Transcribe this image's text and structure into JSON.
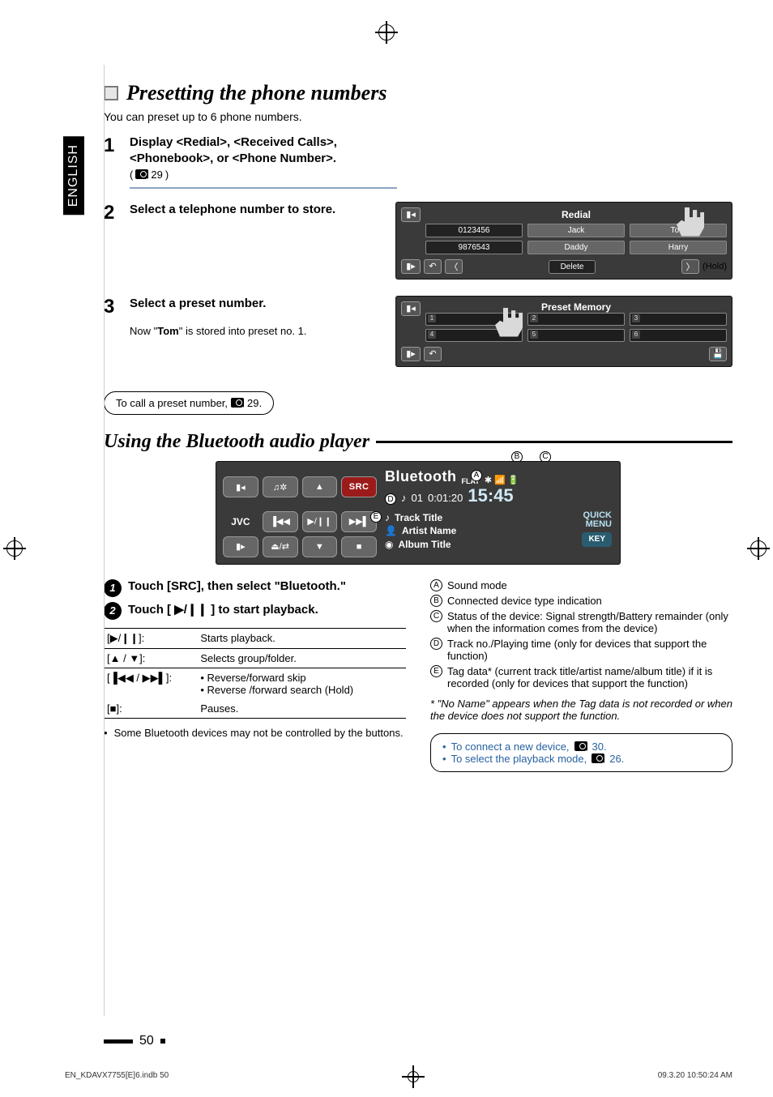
{
  "lang_tab": "ENGLISH",
  "section1": {
    "title": "Presetting the phone numbers",
    "intro": "You can preset up to 6 phone numbers.",
    "steps": [
      {
        "num": "1",
        "title_l1": "Display <Redial>, <Received Calls>,",
        "title_l2": "<Phonebook>, or <Phone Number>.",
        "ref": "29"
      },
      {
        "num": "2",
        "title": "Select a telephone number to store."
      },
      {
        "num": "3",
        "title": "Select a preset number.",
        "note_pre": "Now \"",
        "note_bold": "Tom",
        "note_post": "\" is stored into preset no. 1."
      }
    ],
    "redial_screen": {
      "title": "Redial",
      "cells": [
        "0123456",
        "Jack",
        "Tom",
        "9876543",
        "Daddy",
        "Harry"
      ],
      "delete": "Delete",
      "hold": "(Hold)"
    },
    "preset_screen": {
      "title": "Preset Memory",
      "slots": [
        "1",
        "2",
        "3",
        "4",
        "5",
        "6"
      ]
    },
    "call_note": {
      "pre": "To call a preset number, ",
      "ref": "29."
    }
  },
  "section2": {
    "title": "Using the Bluetooth audio player",
    "player": {
      "brand": "JVC",
      "src": "SRC",
      "bt": "Bluetooth",
      "flat": "FLAT",
      "track_no": "01",
      "time": "0:01:20",
      "clock": "15:45",
      "track_title": "Track Title",
      "artist": "Artist Name",
      "album": "Album Title",
      "quick": "QUICK",
      "menu": "MENU",
      "key": "KEY"
    },
    "callouts": [
      "A",
      "B",
      "C",
      "D",
      "E"
    ],
    "proc1": "Touch [SRC], then select \"Bluetooth.\"",
    "proc2": "Touch [ ▶/❙❙ ] to start playback.",
    "controls": [
      {
        "key": "[▶/❙❙]:",
        "desc": "Starts playback."
      },
      {
        "key": "[▲ / ▼]:",
        "desc": "Selects group/folder."
      },
      {
        "key": "[▐◀◀ / ▶▶▌]:",
        "desc_l1": "• Reverse/forward skip",
        "desc_l2": "• Reverse /forward search (Hold)"
      },
      {
        "key": "[■]:",
        "desc": "Pauses."
      }
    ],
    "bt_note": "Some Bluetooth devices may not be controlled by the buttons.",
    "legend": [
      {
        "l": "A",
        "t": "Sound mode"
      },
      {
        "l": "B",
        "t": "Connected device type indication"
      },
      {
        "l": "C",
        "t": "Status of the device: Signal strength/Battery remainder (only when the information comes from the device)"
      },
      {
        "l": "D",
        "t": "Track no./Playing time (only for devices that support the function)"
      },
      {
        "l": "E",
        "t": "Tag data* (current track title/artist name/album title) if it is recorded (only for devices that support the function)"
      }
    ],
    "star": "* \"No Name\" appears when the Tag data is not recorded or when the device does not support the function.",
    "refbox": [
      {
        "pre": "To connect a new device, ",
        "ref": "30."
      },
      {
        "pre": "To select the playback mode, ",
        "ref": "26."
      }
    ]
  },
  "page_number": "50",
  "footer_left": "EN_KDAVX7755[E]6.indb   50",
  "footer_right": "09.3.20   10:50:24 AM"
}
